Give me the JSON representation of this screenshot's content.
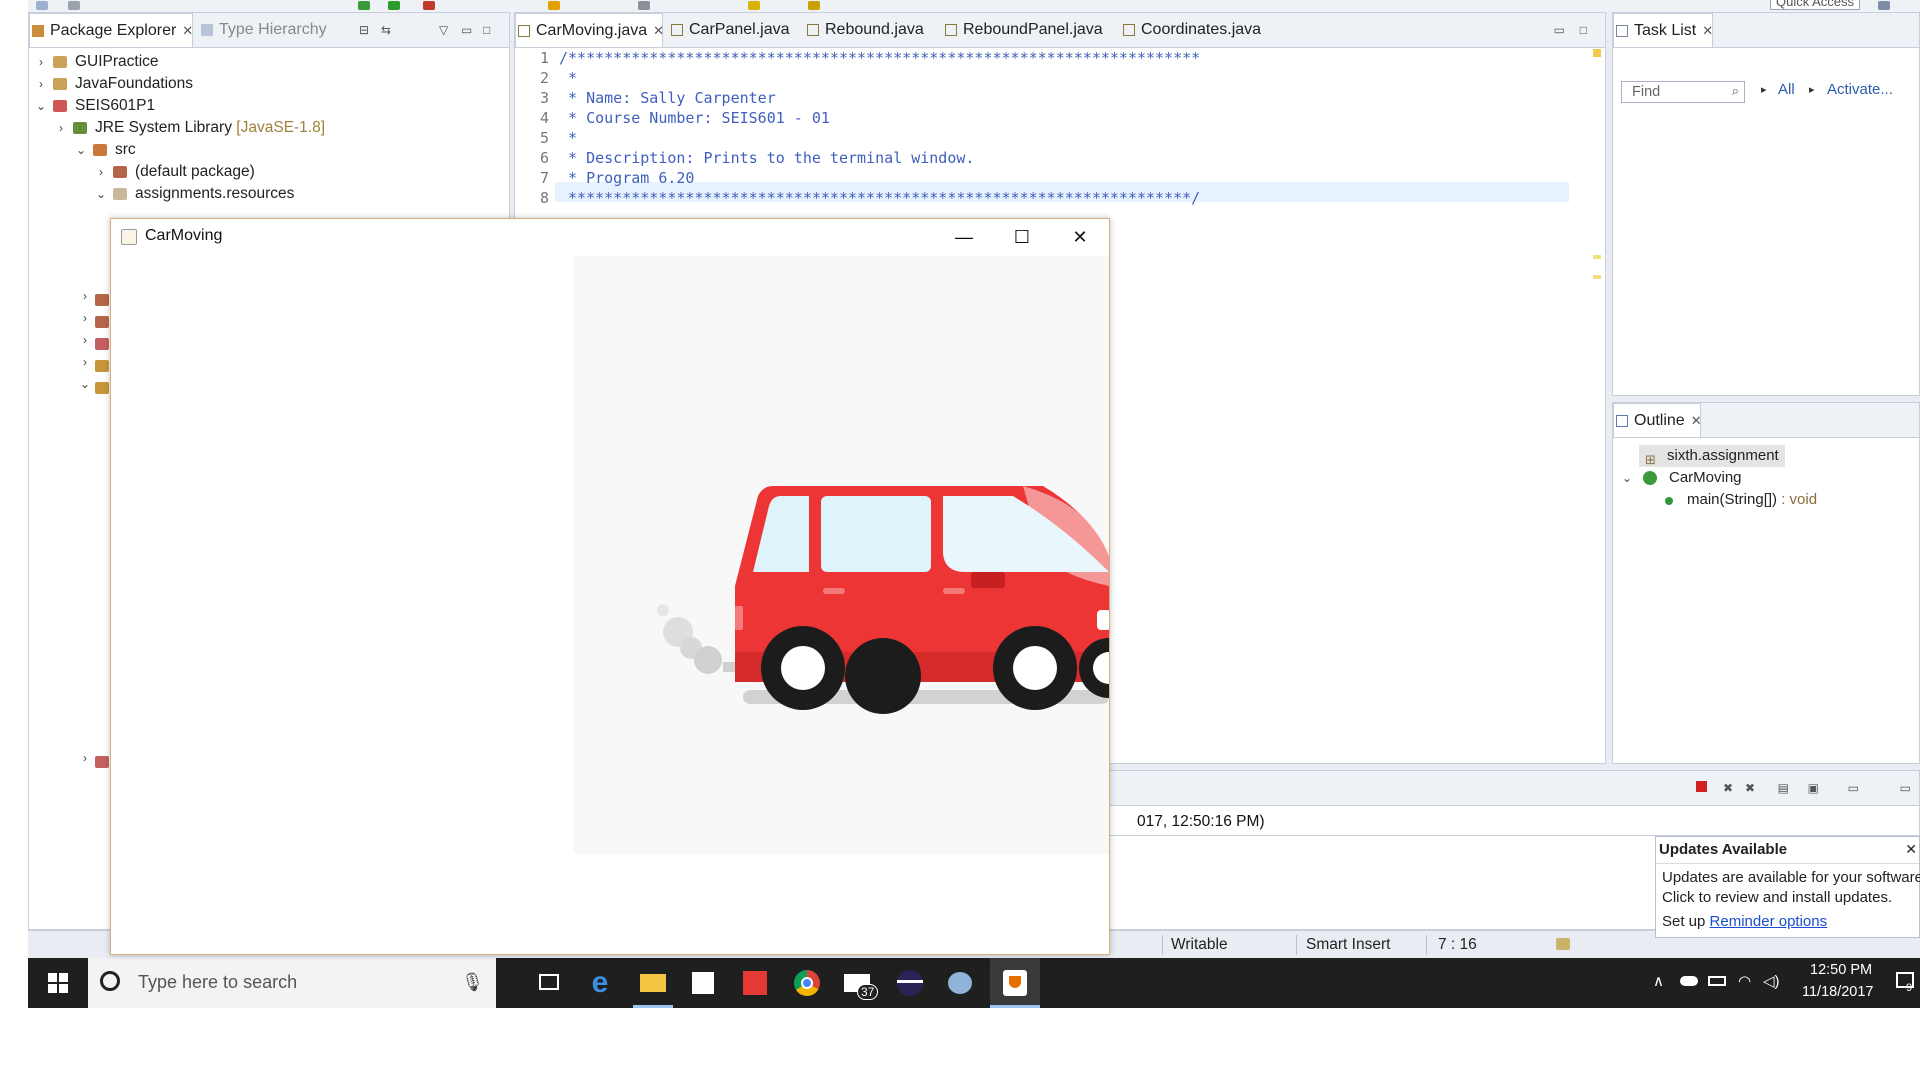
{
  "toolbar": {
    "quick_access": "Quick Access"
  },
  "package_explorer": {
    "tabs": [
      {
        "label": "Package Explorer"
      },
      {
        "label": "Type Hierarchy"
      }
    ],
    "tree": [
      {
        "label": "GUIPractice"
      },
      {
        "label": "JavaFoundations"
      },
      {
        "label": "SEIS601P1"
      },
      {
        "label": "JRE System Library",
        "suffix": "[JavaSE-1.8]"
      },
      {
        "label": "src"
      },
      {
        "label": "(default package)"
      },
      {
        "label": "assignments.resources"
      }
    ]
  },
  "editor": {
    "tabs": [
      {
        "label": "CarMoving.java"
      },
      {
        "label": "CarPanel.java"
      },
      {
        "label": "Rebound.java"
      },
      {
        "label": "ReboundPanel.java"
      },
      {
        "label": "Coordinates.java"
      }
    ],
    "lines": [
      {
        "num": "1",
        "text": "/**********************************************************************"
      },
      {
        "num": "2",
        "text": " *"
      },
      {
        "num": "3",
        "text": " * Name: Sally Carpenter"
      },
      {
        "num": "4",
        "text": " * Course Number: SEIS601 - 01"
      },
      {
        "num": "5",
        "text": " *"
      },
      {
        "num": "6",
        "text": " * Description: Prints to the terminal window."
      },
      {
        "num": "7",
        "text": " * Program 6.20"
      },
      {
        "num": "8",
        "text": " *********************************************************************/"
      }
    ]
  },
  "task_list": {
    "title": "Task List",
    "find_placeholder": "Find",
    "all_label": "All",
    "activate_label": "Activate..."
  },
  "outline": {
    "title": "Outline",
    "package": "sixth.assignment",
    "class_name": "CarMoving",
    "method": "main(String[])",
    "method_type": ": void"
  },
  "console": {
    "timestamp": "017, 12:50:16 PM)"
  },
  "status": {
    "writable": "Writable",
    "insert_mode": "Smart Insert",
    "position": "7 : 16"
  },
  "updates_popup": {
    "title": "Updates Available",
    "line1": "Updates are available for your software",
    "line2": "Click to review and install updates.",
    "line3_prefix": "Set up",
    "link": "Reminder options"
  },
  "java_window": {
    "title": "CarMoving"
  },
  "taskbar": {
    "search_placeholder": "Type here to search",
    "mail_badge": "37",
    "time": "12:50 PM",
    "date": "11/18/2017",
    "notification_count": "9"
  },
  "colors": {
    "car_body": "#ee3535",
    "car_window": "#dff3fa",
    "taskbar": "#1f1f1f",
    "accent": "#0078d7"
  }
}
